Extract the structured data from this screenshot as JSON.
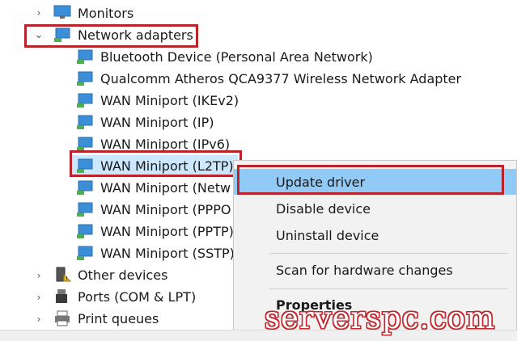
{
  "tree": {
    "monitors": "Monitors",
    "network_adapters": "Network adapters",
    "adapters": [
      "Bluetooth Device (Personal Area Network)",
      "Qualcomm Atheros QCA9377 Wireless Network Adapter",
      "WAN Miniport (IKEv2)",
      "WAN Miniport (IP)",
      "WAN Miniport (IPv6)",
      "WAN Miniport (L2TP)",
      "WAN Miniport (Netw",
      "WAN Miniport (PPPO",
      "WAN Miniport (PPTP)",
      "WAN Miniport (SSTP)"
    ],
    "other_devices": "Other devices",
    "ports": "Ports (COM & LPT)",
    "print_queues": "Print queues"
  },
  "context_menu": {
    "update_driver": "Update driver",
    "disable_device": "Disable device",
    "uninstall_device": "Uninstall device",
    "scan_hardware": "Scan for hardware changes",
    "properties": "Properties"
  },
  "watermark": "serverspc.com",
  "colors": {
    "highlight_box": "#b8242a",
    "menu_hover": "#91c9f7",
    "selection": "#cce8ff"
  }
}
